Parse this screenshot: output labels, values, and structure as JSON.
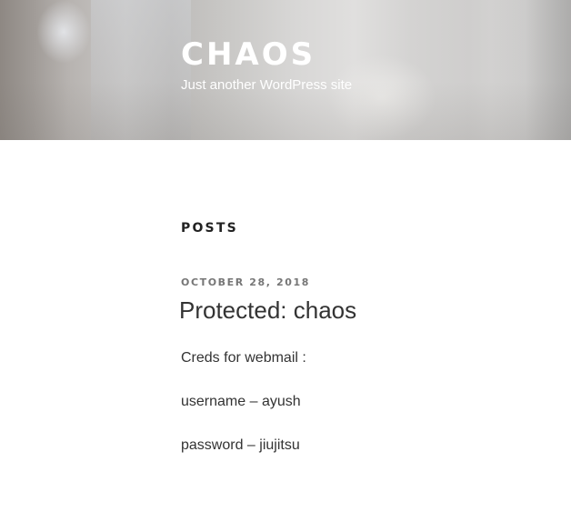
{
  "header": {
    "site_title": "CHAOS",
    "site_description": "Just another WordPress site"
  },
  "main": {
    "section_title": "POSTS",
    "post": {
      "date": "OCTOBER 28, 2018",
      "title": "Protected: chaos",
      "lines": [
        "Creds for webmail :",
        "username – ayush",
        "password – jiujitsu"
      ]
    }
  }
}
